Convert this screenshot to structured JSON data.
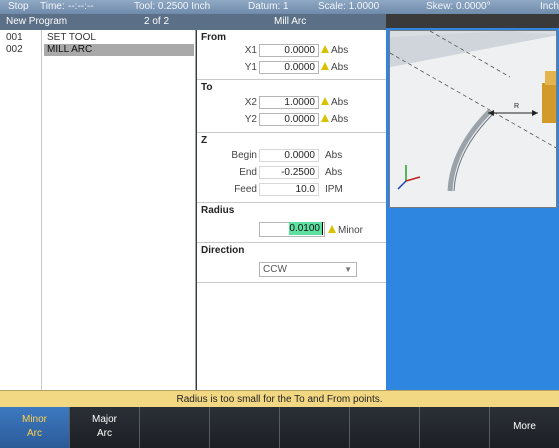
{
  "statusbar": {
    "mode": "Stop",
    "time_label": "Time:",
    "time_value": "--:--:--",
    "tool": "Tool: 0.2500 Inch",
    "datum": "Datum: 1",
    "scale": "Scale: 1.0000",
    "skew": "Skew: 0.0000°",
    "units": "Inch"
  },
  "titlebar": {
    "program": "New Program",
    "step": "2 of 2",
    "operation": "Mill Arc"
  },
  "program_rows": [
    {
      "num": "001",
      "text": "SET TOOL"
    },
    {
      "num": "002",
      "text": "MILL ARC"
    }
  ],
  "form": {
    "from": {
      "title": "From",
      "x1": {
        "label": "X1",
        "value": "0.0000",
        "unit": "Abs"
      },
      "y1": {
        "label": "Y1",
        "value": "0.0000",
        "unit": "Abs"
      }
    },
    "to": {
      "title": "To",
      "x2": {
        "label": "X2",
        "value": "1.0000",
        "unit": "Abs"
      },
      "y2": {
        "label": "Y2",
        "value": "0.0000",
        "unit": "Abs"
      }
    },
    "z": {
      "title": "Z",
      "begin": {
        "label": "Begin",
        "value": "0.0000",
        "unit": "Abs"
      },
      "end": {
        "label": "End",
        "value": "-0.2500",
        "unit": "Abs"
      },
      "feed": {
        "label": "Feed",
        "value": "10.0",
        "unit": "IPM"
      }
    },
    "radius": {
      "title": "Radius",
      "value": "0.0100",
      "unit": "Minor"
    },
    "direction": {
      "title": "Direction",
      "value": "CCW"
    }
  },
  "preview": {
    "dimension_label": "R"
  },
  "message": "Radius is too small for the To and From points.",
  "softkeys": {
    "minor_l1": "Minor",
    "minor_l2": "Arc",
    "major_l1": "Major",
    "major_l2": "Arc",
    "more": "More"
  },
  "colors": {
    "accent_active_key": "#3e79c0",
    "warning": "#d8c200",
    "highlight_field": "#5fe0a0",
    "message_bg": "#f3d884"
  }
}
